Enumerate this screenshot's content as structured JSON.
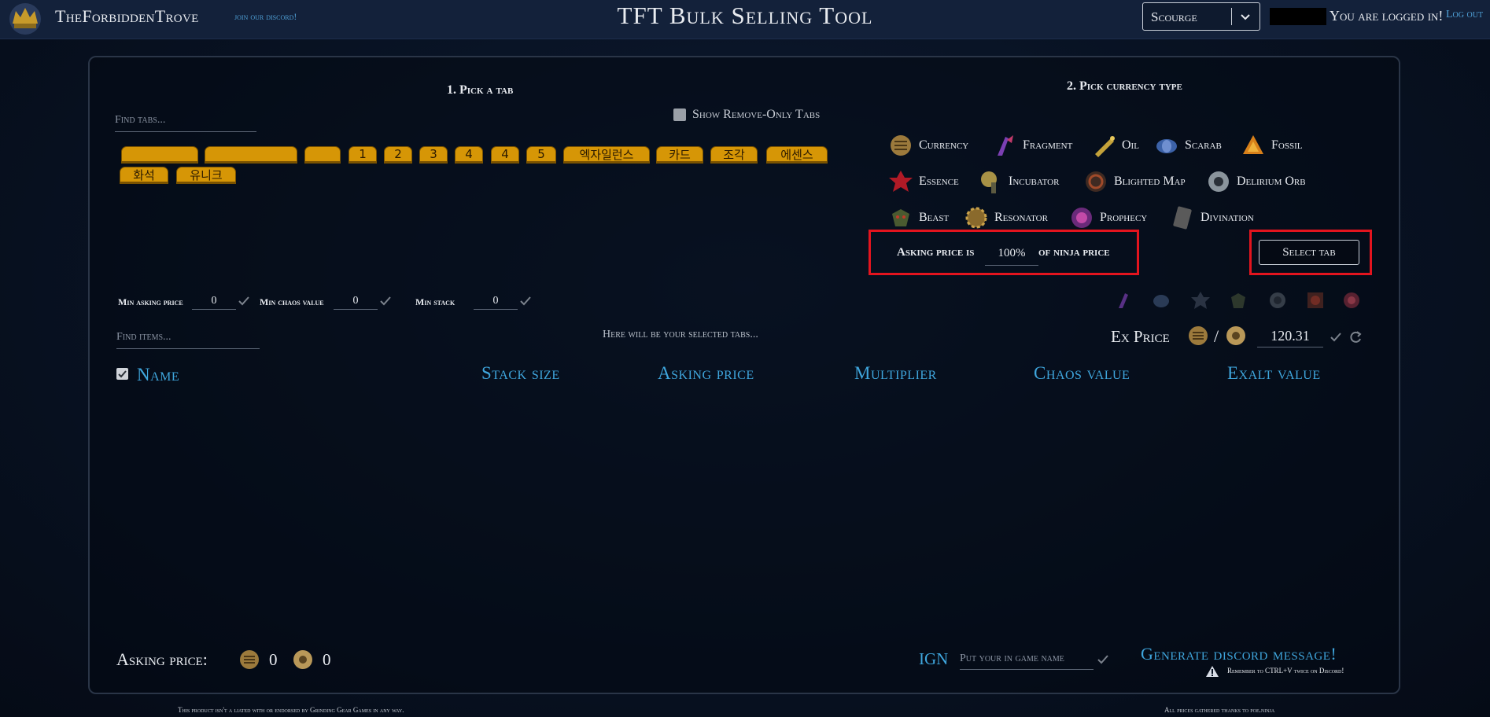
{
  "header": {
    "site_name": "TheForbiddenTrove",
    "discord_link": "join our discord!",
    "app_title": "TFT Bulk Selling Tool",
    "league": "Scourge",
    "logged_in_text": "You are logged in!",
    "logout": "Log out"
  },
  "tabs_section": {
    "title": "1. Pick a tab",
    "search_placeholder": "Find tabs...",
    "show_remove_only_label": "Show Remove-Only Tabs",
    "tabs": [
      "",
      "",
      "",
      "1",
      "2",
      "3",
      "4",
      "4",
      "5",
      "엑자일런스",
      "카드",
      "조각",
      "에센스",
      "화석",
      "유니크"
    ]
  },
  "currency_section": {
    "title": "2. Pick currency type",
    "types": [
      {
        "label": "Currency",
        "icon": "currency-icon"
      },
      {
        "label": "Fragment",
        "icon": "fragment-icon"
      },
      {
        "label": "Oil",
        "icon": "oil-icon"
      },
      {
        "label": "Scarab",
        "icon": "scarab-icon"
      },
      {
        "label": "Fossil",
        "icon": "fossil-icon"
      },
      {
        "label": "Essence",
        "icon": "essence-icon"
      },
      {
        "label": "Incubator",
        "icon": "incubator-icon"
      },
      {
        "label": "Blighted Map",
        "icon": "blighted-map-icon"
      },
      {
        "label": "Delirium Orb",
        "icon": "delirium-orb-icon"
      },
      {
        "label": "Beast",
        "icon": "beast-icon"
      },
      {
        "label": "Resonator",
        "icon": "resonator-icon"
      },
      {
        "label": "Prophecy",
        "icon": "prophecy-icon"
      },
      {
        "label": "Divination",
        "icon": "divination-icon"
      }
    ],
    "asking_price_label": "Asking price is",
    "asking_price_pct": "100%",
    "asking_price_suffix": "of ninja price",
    "select_tab_button": "Select tab"
  },
  "filters": {
    "min_asking_label": "Min asking price",
    "min_asking_value": "0",
    "min_chaos_label": "Min chaos value",
    "min_chaos_value": "0",
    "min_stack_label": "Min stack",
    "min_stack_value": "0",
    "find_items_placeholder": "Find items...",
    "selected_tabs_text": "Here will be your selected tabs..."
  },
  "ex_price": {
    "label": "Ex Price",
    "value": "120.31"
  },
  "table": {
    "columns": [
      "Name",
      "Stack size",
      "Asking price",
      "Multiplier",
      "Chaos value",
      "Exalt value"
    ]
  },
  "footer": {
    "asking_label": "Asking price:",
    "chaos_total": "0",
    "exalt_total": "0",
    "ign_label": "IGN",
    "ign_placeholder": "Put your in game name",
    "generate_button": "Generate discord message!",
    "ctrl_v_note": "Remember to CTRL+V twice on Discord!",
    "disclaimer": "This product isn't a   liated with or endorsed by Grinding Gear Games in any way.",
    "prices_credit": "All prices gathered thanks to poe.ninja"
  },
  "colors": {
    "accent_blue": "#3fa6dd",
    "tab_gold": "#d69606",
    "highlight_red": "#e3141e"
  }
}
